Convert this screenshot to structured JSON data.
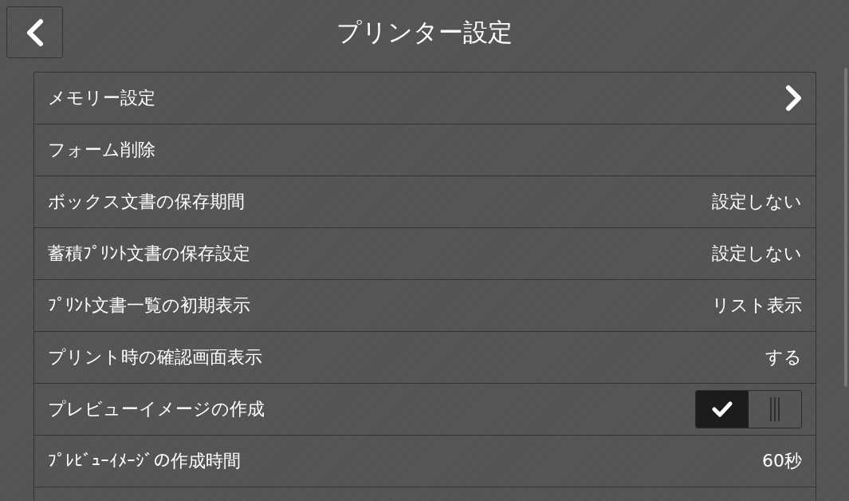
{
  "header": {
    "title": "プリンター設定"
  },
  "rows": [
    {
      "kind": "link",
      "label": "メモリー設定"
    },
    {
      "kind": "plain",
      "label": "フォーム削除"
    },
    {
      "kind": "value",
      "label": "ボックス文書の保存期間",
      "value": "設定しない"
    },
    {
      "kind": "value",
      "label": "蓄積ﾌﾟﾘﾝﾄ文書の保存設定",
      "value": "設定しない"
    },
    {
      "kind": "value",
      "label": "ﾌﾟﾘﾝﾄ文書一覧の初期表示",
      "value": "リスト表示"
    },
    {
      "kind": "value",
      "label": "プリント時の確認画面表示",
      "value": "する"
    },
    {
      "kind": "toggle",
      "label": "プレビューイメージの作成",
      "on": true
    },
    {
      "kind": "value",
      "label": "ﾌﾟﾚﾋﾞｭｰｲﾒｰｼﾞの作成時間",
      "value": "60秒"
    }
  ]
}
